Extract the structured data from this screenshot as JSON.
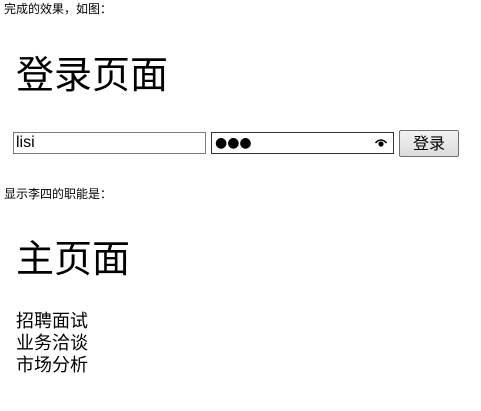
{
  "captions": {
    "done": "完成的效果，如图：",
    "show": "显示李四的职能是："
  },
  "login_page": {
    "title": "登录页面",
    "username_value": "lisi",
    "password_mask": "●●●",
    "submit_label": "登录"
  },
  "main_page": {
    "title": "主页面",
    "duties": [
      "招聘面试",
      "业务洽谈",
      "市场分析"
    ]
  },
  "icons": {
    "password_reveal": "eye-icon"
  }
}
